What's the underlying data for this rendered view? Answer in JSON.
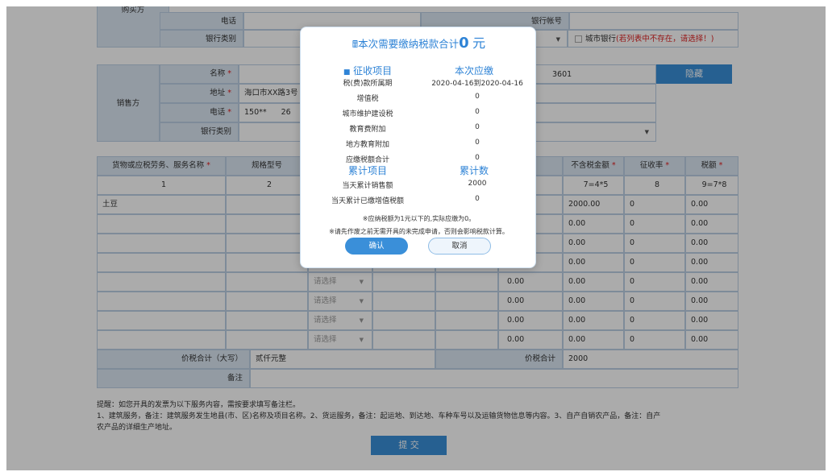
{
  "buyer": {
    "section_label": "购买方",
    "phone_label": "电话",
    "bank_account_label": "银行帐号",
    "bank_type_label": "银行类别",
    "city_bank_label": "城市银行",
    "city_bank_hint": "(若列表中不存在，请选择！)"
  },
  "seller": {
    "section_label": "销售方",
    "name_label": "名称",
    "address_label": "地址",
    "address_value": "海口市XX路3号",
    "phone_label": "电话",
    "phone_value_a": "150**",
    "phone_value_b": "26",
    "bank_type_label": "银行类别",
    "account_fragment": "3601",
    "hide_button": "隐藏",
    "required_mark": "*"
  },
  "goods_table": {
    "headers": [
      "货物或应税劳务、服务名称",
      "规格型号",
      "不含税金额",
      "征收率",
      "税额"
    ],
    "formula_row": [
      "1",
      "2",
      "7=4*5",
      "8",
      "9=7*8"
    ],
    "rows": [
      {
        "name": "土豆",
        "select": "",
        "amount": "",
        "exclusive": "2000.00",
        "rate": "0",
        "tax": "0.00"
      },
      {
        "name": "",
        "select": "",
        "amount": "",
        "exclusive": "0.00",
        "rate": "0",
        "tax": "0.00"
      },
      {
        "name": "",
        "select": "",
        "amount": "",
        "exclusive": "0.00",
        "rate": "0",
        "tax": "0.00"
      },
      {
        "name": "",
        "select": "",
        "amount": "",
        "exclusive": "0.00",
        "rate": "0",
        "tax": "0.00"
      },
      {
        "name": "",
        "select": "请选择",
        "amount": "0.00",
        "exclusive": "0.00",
        "rate": "0",
        "tax": "0.00"
      },
      {
        "name": "",
        "select": "请选择",
        "amount": "0.00",
        "exclusive": "0.00",
        "rate": "0",
        "tax": "0.00"
      },
      {
        "name": "",
        "select": "请选择",
        "amount": "0.00",
        "exclusive": "0.00",
        "rate": "0",
        "tax": "0.00"
      },
      {
        "name": "",
        "select": "请选择",
        "amount": "0.00",
        "exclusive": "0.00",
        "rate": "0",
        "tax": "0.00"
      }
    ],
    "total_upper_label": "价税合计（大写）",
    "total_upper_value": "贰仟元整",
    "total_label": "价税合计",
    "total_value": "2000",
    "remark_label": "备注"
  },
  "notes": {
    "line1": "提醒：如您开具的发票为以下服务内容，需按要求填写备注栏。",
    "line2": "1、建筑服务，备注：建筑服务发生地县(市、区)名称及项目名称。2、货运服务，备注：起运地、到达地、车种车号以及运输货物信息等内容。3、自产自销农产品，备注：自产",
    "line3": "农产品的详细生产地址。",
    "submit": "提 交"
  },
  "modal": {
    "title_prefix": "本次需要缴纳税款合计",
    "title_amount": "0",
    "title_unit": "元",
    "col_item": "征收项目",
    "col_due": "本次应缴",
    "rows": [
      {
        "label": "税(费)款所属期",
        "value": "2020-04-16到2020-04-16"
      },
      {
        "label": "增值税",
        "value": "0"
      },
      {
        "label": "城市维护建设税",
        "value": "0"
      },
      {
        "label": "教育费附加",
        "value": "0"
      },
      {
        "label": "地方教育附加",
        "value": "0"
      },
      {
        "label": "应缴税额合计",
        "value": "0"
      }
    ],
    "cum_item": "累计项目",
    "cum_value": "累计数",
    "cum_rows": [
      {
        "label": "当天累计销售额",
        "value": "2000"
      },
      {
        "label": "当天累计已缴增值税额",
        "value": "0"
      }
    ],
    "note1": "※应纳税额为1元以下的,实际应缴为0。",
    "note2": "※请先作废之前无需开具的未完成申请，否则会影响税款计算。",
    "confirm": "确认",
    "cancel": "取消"
  }
}
